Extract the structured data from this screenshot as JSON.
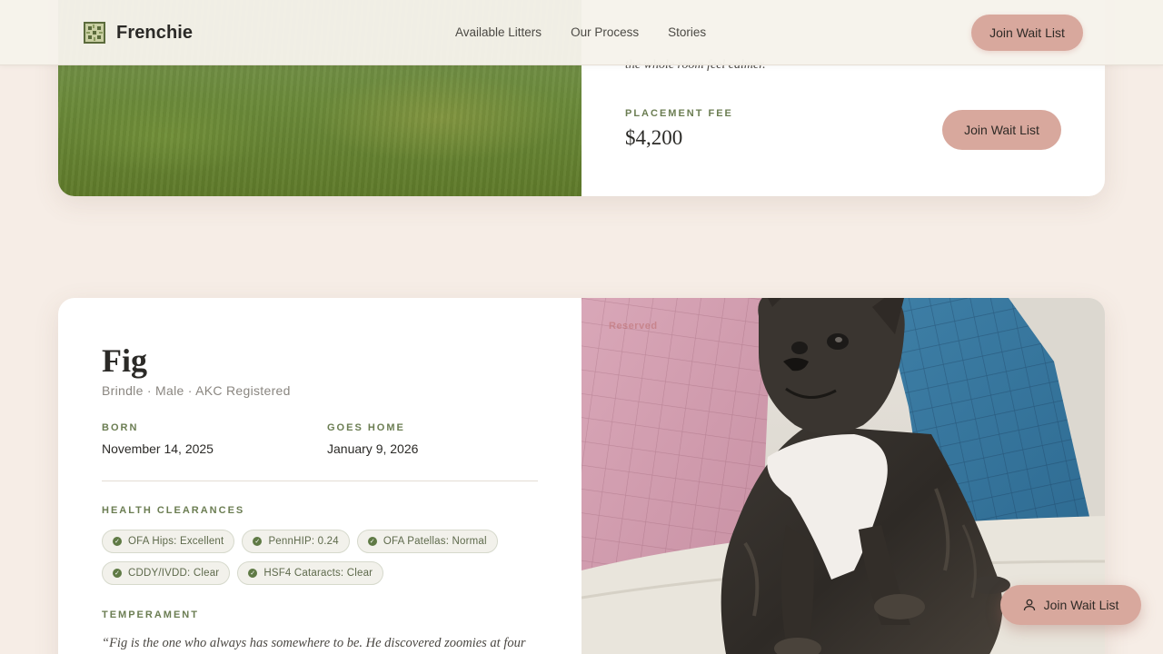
{
  "header": {
    "brand": "Frenchie",
    "nav": [
      "Available Litters",
      "Our Process",
      "Stories"
    ],
    "cta": "Join Wait List"
  },
  "card_prev": {
    "quote_fragment": "the whole room feel calmer.",
    "fee_label": "PLACEMENT FEE",
    "fee_value": "$4,200",
    "cta": "Join Wait List"
  },
  "card_fig": {
    "name": "Fig",
    "meta": "Brindle · Male · AKC Registered",
    "born_label": "BORN",
    "born_value": "November 14, 2025",
    "goes_home_label": "GOES HOME",
    "goes_home_value": "January 9, 2026",
    "health_label": "HEALTH CLEARANCES",
    "clearances": [
      "OFA Hips: Excellent",
      "PennHIP: 0.24",
      "OFA Patellas: Normal",
      "CDDY/IVDD: Clear",
      "HSF4 Cataracts: Clear"
    ],
    "temperament_label": "TEMPERAMENT",
    "temperament_quote": "“Fig is the one who always has somewhere to be. He discovered zoomies at four",
    "status_tag": "Reserved"
  },
  "floating_cta": {
    "label": "Join Wait List",
    "icon": "user-icon"
  },
  "colors": {
    "accent": "#d8a89d",
    "olive": "#6b7d52",
    "background": "#f6ede6"
  }
}
